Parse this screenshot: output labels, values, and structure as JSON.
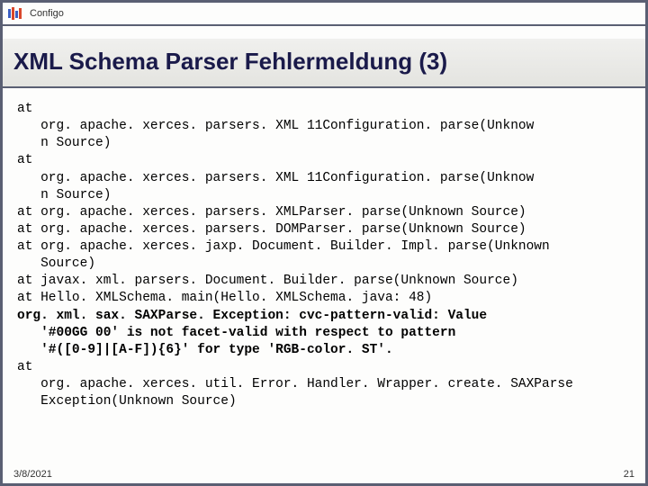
{
  "header": {
    "brand": "Configo"
  },
  "title": "XML Schema Parser Fehlermeldung (3)",
  "trace": {
    "l1": "at",
    "l2": "   org. apache. xerces. parsers. XML 11Configuration. parse(Unknow",
    "l3": "   n Source)",
    "l4": "at",
    "l5": "   org. apache. xerces. parsers. XML 11Configuration. parse(Unknow",
    "l6": "   n Source)",
    "l7": "at org. apache. xerces. parsers. XMLParser. parse(Unknown Source)",
    "l8": "at org. apache. xerces. parsers. DOMParser. parse(Unknown Source)",
    "l9": "at org. apache. xerces. jaxp. Document. Builder. Impl. parse(Unknown",
    "l10": "   Source)",
    "l11": "at javax. xml. parsers. Document. Builder. parse(Unknown Source)",
    "l12": "at Hello. XMLSchema. main(Hello. XMLSchema. java: 48)",
    "l13": "org. xml. sax. SAXParse. Exception: cvc-pattern-valid: Value",
    "l14": "   '#00GG 00' is not facet-valid with respect to pattern",
    "l15": "   '#([0-9]|[A-F]){6}' for type 'RGB-color. ST'.",
    "l16": "at",
    "l17": "   org. apache. xerces. util. Error. Handler. Wrapper. create. SAXParse",
    "l18": "   Exception(Unknown Source)"
  },
  "footer": {
    "date": "3/8/2021",
    "page": "21"
  }
}
